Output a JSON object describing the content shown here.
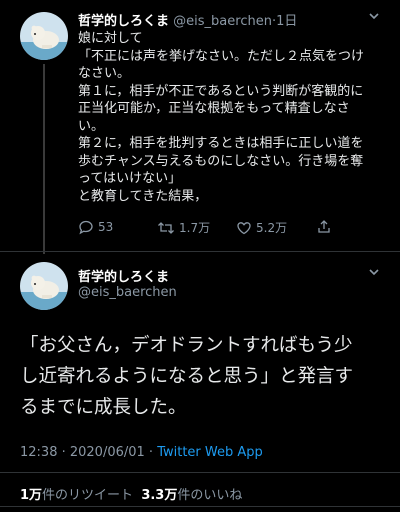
{
  "tweet1": {
    "name": "哲学的しろくま",
    "handle": "@eis_baerchen",
    "time": "1日",
    "caret_icon": "chevron-down-icon",
    "lines": [
      "娘に対して",
      "「不正には声を挙げなさい。ただし２点気をつけ",
      "なさい。",
      "第１に，相手が不正であるという判断が客観的に",
      "正当化可能か，正当な根拠をもって精査しなさ",
      "い。",
      "第２に，相手を批判するときは相手に正しい道を",
      "歩むチャンス与えるものにしなさい。行き場を奪",
      "ってはいけない」",
      "と教育してきた結果，"
    ],
    "replies": "53",
    "retweets": "1.7万",
    "likes": "5.2万"
  },
  "tweet2": {
    "name": "哲学的しろくま",
    "handle": "@eis_baerchen",
    "caret_icon": "chevron-down-icon",
    "lines": [
      "「お父さん，デオドラントすればもう少",
      "し近寄れるようになると思う」と発言す",
      "るまでに成長した。"
    ],
    "timestamp": "12:38 · 2020/06/01 · ",
    "app": "Twitter Web App",
    "rt_count": "1万",
    "rt_label": "件のリツイート",
    "like_count": "3.3万",
    "like_label": "件のいいね"
  }
}
